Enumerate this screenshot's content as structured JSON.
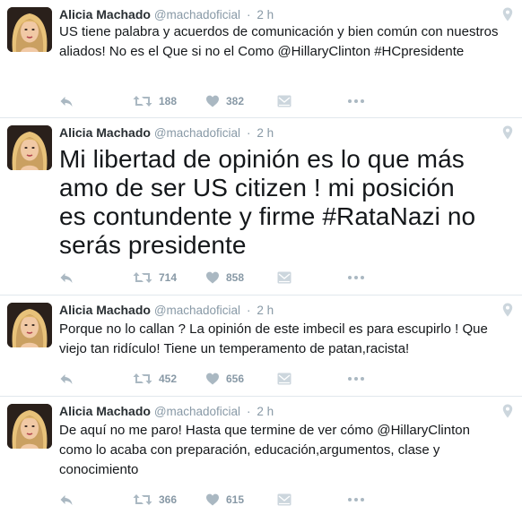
{
  "tweets": [
    {
      "name": "Alicia Machado",
      "handle": "@machadoficial",
      "time": "2 h",
      "text": "US tiene palabra y acuerdos de comunicación y bien común con nuestros aliados! No es el Que si no el Como @HillaryClinton #HCpresidente",
      "retweets": "188",
      "likes": "382"
    },
    {
      "name": "Alicia Machado",
      "handle": "@machadoficial",
      "time": "2 h",
      "text": "Mi libertad de opinión es lo que más amo de ser US citizen ! mi posición es contundente y firme #RataNazi no serás presidente",
      "retweets": "714",
      "likes": "858"
    },
    {
      "name": "Alicia Machado",
      "handle": "@machadoficial",
      "time": "2 h",
      "text": "Porque no lo callan ? La opinión de este imbecil es para escupirlo ! Que viejo tan ridículo! Tiene un temperamento de patan,racista!",
      "retweets": "452",
      "likes": "656"
    },
    {
      "name": "Alicia Machado",
      "handle": "@machadoficial",
      "time": "2 h",
      "text": "De aquí no me paro! Hasta que termine de ver cómo @HillaryClinton como lo acaba  con preparación, educación,argumentos, clase y conocimiento",
      "retweets": "366",
      "likes": "615"
    }
  ],
  "separator": "·",
  "icons": {
    "reply": "reply-icon",
    "retweet": "retweet-icon",
    "like": "heart-icon",
    "dm": "direct-message-icon",
    "more": "more-icon",
    "geo": "location-pin-icon"
  },
  "colors": {
    "icon": "#aab8c2",
    "meta": "#8899a6",
    "text": "#14171a",
    "border": "#e1e8ed"
  }
}
